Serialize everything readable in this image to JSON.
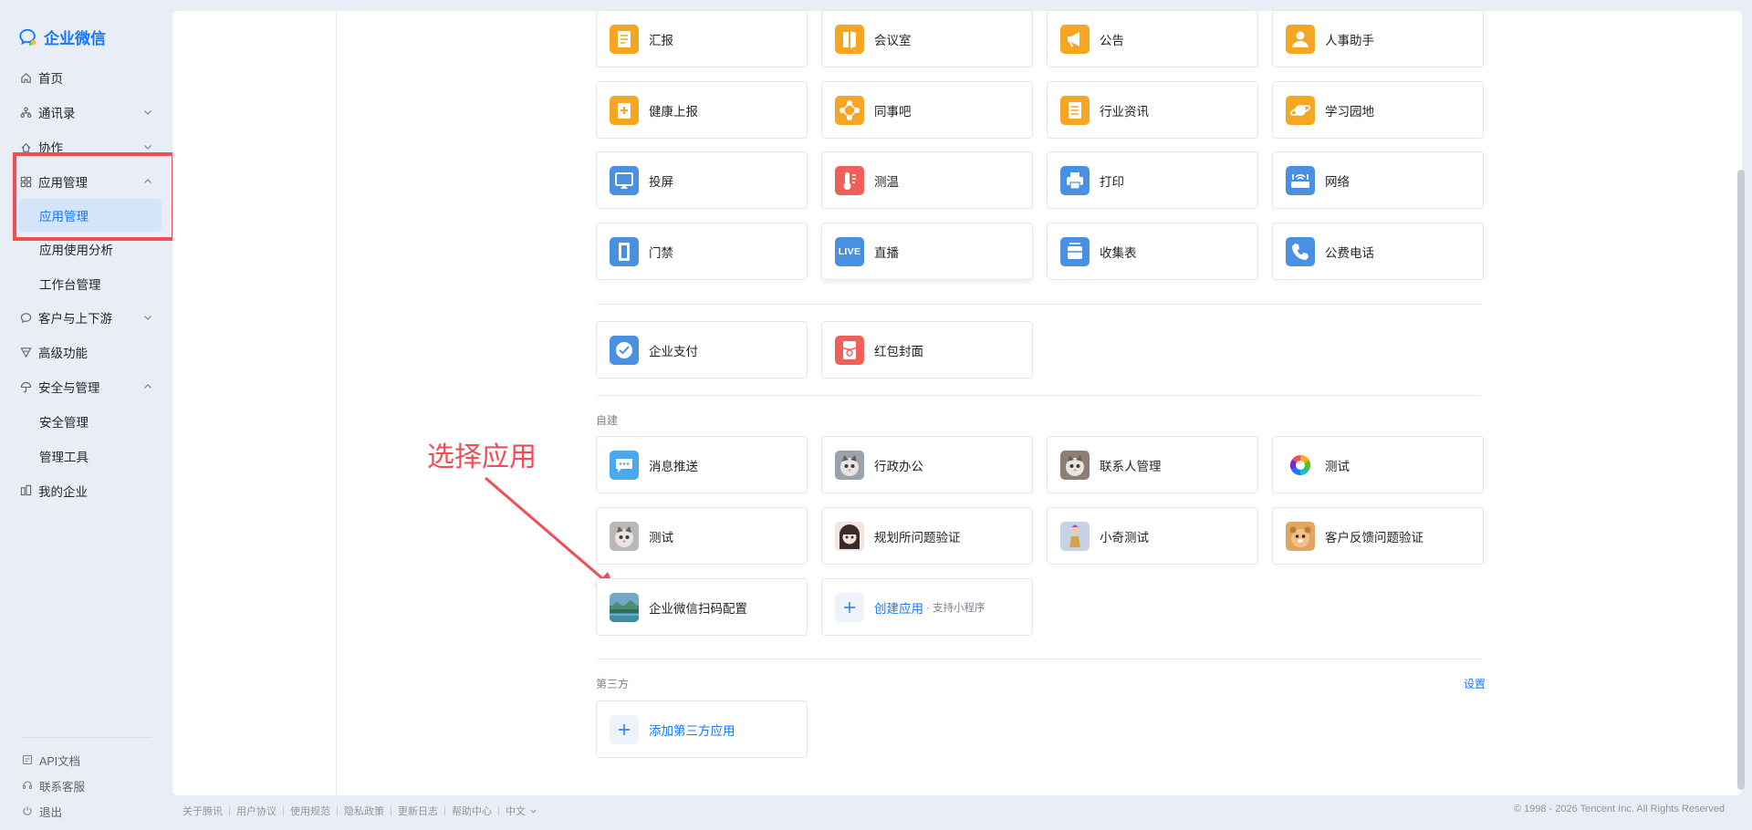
{
  "brand": {
    "name": "企业微信",
    "color": "#1677ff"
  },
  "sidebar": {
    "items": [
      {
        "label": "首页",
        "icon": "home-icon"
      },
      {
        "label": "通讯录",
        "icon": "org-icon",
        "expand": "collapsed"
      },
      {
        "label": "协作",
        "icon": "collab-icon",
        "expand": "collapsed"
      },
      {
        "label": "应用管理",
        "icon": "apps-grid-icon",
        "expand": "expanded"
      },
      {
        "label": "应用管理",
        "sub": true,
        "active": true
      },
      {
        "label": "应用使用分析",
        "sub": true
      },
      {
        "label": "工作台管理",
        "sub": true
      },
      {
        "label": "客户与上下游",
        "icon": "chat-bubble-icon",
        "expand": "collapsed"
      },
      {
        "label": "高级功能",
        "icon": "filter-icon"
      },
      {
        "label": "安全与管理",
        "icon": "umbrella-icon",
        "expand": "expanded"
      },
      {
        "label": "安全管理",
        "sub": true
      },
      {
        "label": "管理工具",
        "sub": true
      },
      {
        "label": "我的企业",
        "icon": "company-icon"
      }
    ],
    "footer": [
      {
        "label": "API文档",
        "icon": "doc-icon"
      },
      {
        "label": "联系客服",
        "icon": "headset-icon"
      },
      {
        "label": "退出",
        "icon": "power-icon"
      }
    ]
  },
  "apps_builtin": [
    {
      "name": "汇报",
      "icon": "report-icon",
      "color": "#f5a623"
    },
    {
      "name": "会议室",
      "icon": "door-icon",
      "color": "#f5a623"
    },
    {
      "name": "公告",
      "icon": "megaphone-icon",
      "color": "#f5a623"
    },
    {
      "name": "人事助手",
      "icon": "person-icon",
      "color": "#f5a623"
    },
    {
      "name": "健康上报",
      "icon": "health-icon",
      "color": "#f5a623"
    },
    {
      "name": "同事吧",
      "icon": "network-icon",
      "color": "#f5a623"
    },
    {
      "name": "行业资讯",
      "icon": "news-icon",
      "color": "#f5a623"
    },
    {
      "name": "学习园地",
      "icon": "planet-icon",
      "color": "#f5a623"
    },
    {
      "name": "投屏",
      "icon": "cast-icon",
      "color": "#4a90e2"
    },
    {
      "name": "测温",
      "icon": "thermometer-icon",
      "color": "#f0605a"
    },
    {
      "name": "打印",
      "icon": "printer-icon",
      "color": "#4a90e2"
    },
    {
      "name": "网络",
      "icon": "router-icon",
      "color": "#4a90e2"
    },
    {
      "name": "门禁",
      "icon": "gate-icon",
      "color": "#4a90e2"
    },
    {
      "name": "直播",
      "icon": "live-icon",
      "color": "#4a90e2",
      "badge": "LIVE"
    },
    {
      "name": "收集表",
      "icon": "tray-icon",
      "color": "#4a90e2"
    },
    {
      "name": "公费电话",
      "icon": "phone-icon",
      "color": "#4a90e2"
    }
  ],
  "apps_payment": [
    {
      "name": "企业支付",
      "icon": "pay-icon",
      "color": "#4a90e2"
    },
    {
      "name": "红包封面",
      "icon": "red-packet-icon",
      "color": "#f0605a"
    }
  ],
  "custom_section": {
    "label": "自建",
    "apps": [
      {
        "name": "消息推送",
        "icon": "message-icon",
        "color": "#4aa8f0"
      },
      {
        "name": "行政办公",
        "icon": "cat-avatar-icon",
        "color": "#9aa3ad"
      },
      {
        "name": "联系人管理",
        "icon": "cat-avatar-icon",
        "color": "#8d7d72"
      },
      {
        "name": "测试",
        "icon": "color-wheel-icon",
        "color": "#ffffff"
      },
      {
        "name": "测试",
        "icon": "cat-avatar-icon",
        "color": "#b8b8b8"
      },
      {
        "name": "规划所问题验证",
        "icon": "girl-avatar-icon",
        "color": "#5a4a4a"
      },
      {
        "name": "小奇测试",
        "icon": "figure-avatar-icon",
        "color": "#8da0c0"
      },
      {
        "name": "客户反馈问题验证",
        "icon": "hamster-avatar-icon",
        "color": "#c07a3a"
      },
      {
        "name": "企业微信扫码配置",
        "icon": "landscape-avatar-icon",
        "color": "#3a7a6a"
      }
    ],
    "create": {
      "label": "创建应用",
      "note": "· 支持小程序"
    }
  },
  "third_party": {
    "label": "第三方",
    "settings": "设置",
    "add_label": "添加第三方应用"
  },
  "annotation": {
    "text": "选择应用",
    "color": "#f04d55"
  },
  "footer": {
    "links": [
      "关于腾讯",
      "用户协议",
      "使用规范",
      "隐私政策",
      "更新日志",
      "帮助中心",
      "中文"
    ],
    "copyright": "© 1998 - 2026 Tencent Inc. All Rights Reserved"
  }
}
